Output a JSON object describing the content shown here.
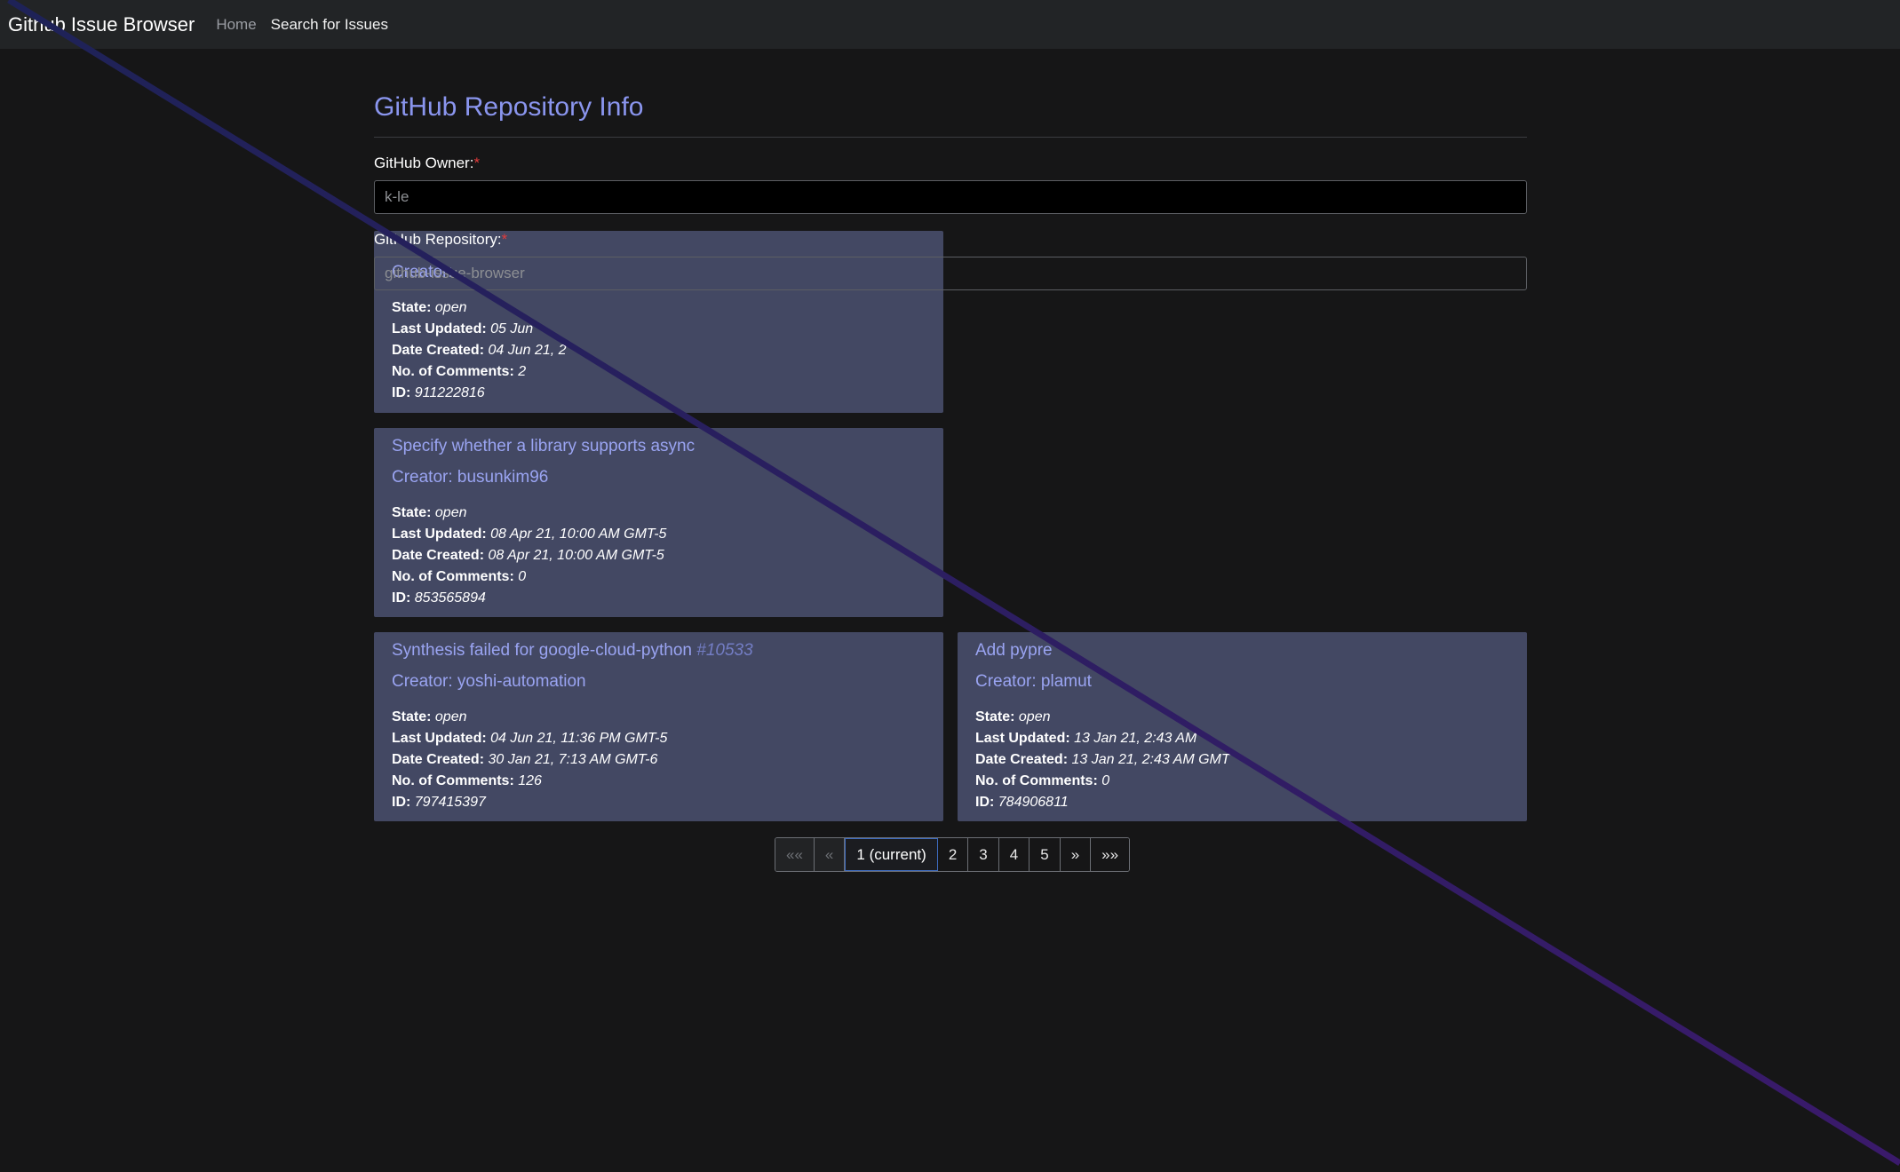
{
  "navbar": {
    "brand": "Github Issue Browser",
    "links": [
      "Home",
      "Search for Issues"
    ]
  },
  "page": {
    "title": "GitHub Repository Info"
  },
  "form": {
    "owner_label": "GitHub Owner:",
    "owner_value": "k-le",
    "repo_label": "GitHub Repository:",
    "repo_value": "github-issue-browser",
    "required_mark": "*"
  },
  "issues": [
    {
      "creator": "Creator: ",
      "state": "open",
      "last_updated": "05 Jun",
      "date_created": "04 Jun 21, 2",
      "comments": "2",
      "id": "911222816"
    },
    {
      "title": "Specify whether a library supports async",
      "creator": "Creator: busunkim96",
      "state": "open",
      "last_updated": "08 Apr 21, 10:00 AM GMT-5",
      "date_created": "08 Apr 21, 10:00 AM GMT-5",
      "comments": "0",
      "id": "853565894"
    },
    {
      "title": "Synthesis failed for google-cloud-python",
      "number": "#10533",
      "creator": "Creator: yoshi-automation",
      "state": "open",
      "last_updated": "04 Jun 21, 11:36 PM GMT-5",
      "date_created": "30 Jan 21, 7:13 AM GMT-6",
      "comments": "126",
      "id": "797415397"
    },
    {
      "title": "Add pypre",
      "creator": "Creator: plamut",
      "state": "open",
      "last_updated": "13 Jan 21, 2:43 AM",
      "date_created": "13 Jan 21, 2:43 AM GMT",
      "comments": "0",
      "id": "784906811"
    }
  ],
  "labels": {
    "state": "State:",
    "last_updated": "Last Updated:",
    "date_created": "Date Created:",
    "comments": "No. of Comments:",
    "id": "ID:"
  },
  "pagination": {
    "first": "««",
    "prev": "«",
    "current": "1 (current)",
    "pages": [
      "2",
      "3",
      "4",
      "5"
    ],
    "next": "»",
    "last": "»»"
  },
  "colors": {
    "background": "#161617",
    "navbar": "#222426",
    "card": "#434863",
    "accent": "#8a95ee",
    "diagonal_line": "#1f1f70"
  }
}
